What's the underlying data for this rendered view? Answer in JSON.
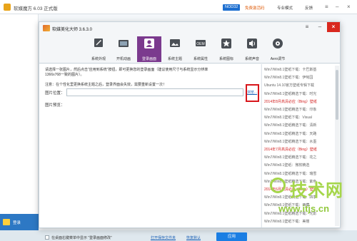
{
  "back_window": {
    "title": "软媒魔方 6.03 正式版",
    "nod_badge": "NOD32",
    "nod_text": "免费激活码",
    "menus": [
      "专业模式",
      "反馈"
    ],
    "bottom_label": "登录"
  },
  "dialog": {
    "title": "软媒美化大师 3.6.3.0",
    "toolbar": [
      {
        "label": "系统外观",
        "icon": "monitor-icon"
      },
      {
        "label": "开机动画",
        "icon": "boot-animation-icon"
      },
      {
        "label": "登录画面",
        "icon": "user-login-icon",
        "active": true
      },
      {
        "label": "系统主题",
        "icon": "theme-icon"
      },
      {
        "label": "系统属性",
        "icon": "system-properties-icon"
      },
      {
        "label": "系统图标",
        "icon": "star-icon"
      },
      {
        "label": "系统声音",
        "icon": "speaker-icon"
      },
      {
        "label": "Aero调节",
        "icon": "aero-icon"
      }
    ],
    "description": "请选择一张图片，然后点击“应用到系统”按钮，即可更换您的登录画面（建议使用尺寸与系统显示分辨率1366x768一致的图片）。",
    "note": "注意：在个性化里更换系统主题之后，登录界面会失效，需要重新设置一次！",
    "image_location_label": "图片位置：",
    "image_location_value": "",
    "browse_label": "浏览...",
    "preview_label": "图片预览：",
    "context_menu_checkbox_label": "在桌面右键菜单中显示 “登录画面修改”",
    "open_folder_link": "打开保存文件夹",
    "restore_default_link": "恢复默认",
    "apply_button": "应用"
  },
  "articles": [
    {
      "text": "Win7/Win8.1壁纸下载：卡巴斯基",
      "style": "gray"
    },
    {
      "text": "Win7/Win8.1壁纸下载：伊甸园",
      "style": "gray"
    },
    {
      "text": "Ubuntu 14.10官方壁纸专辑下载",
      "style": "gray"
    },
    {
      "text": "Win7/Win8.1壁纸精选下载：时光",
      "style": "gray"
    },
    {
      "text": "2014年8月高清必应（Bing）壁纸",
      "style": "red"
    },
    {
      "text": "Win7/Win8.1壁纸精选下载：印象",
      "style": "gray"
    },
    {
      "text": "Win7/Win8.1壁纸下载：Visual",
      "style": "gray"
    },
    {
      "text": "Win7/Win8.1壁纸精选下载：清新",
      "style": "gray"
    },
    {
      "text": "Win7/Win8.1壁纸精选下载：天路",
      "style": "gray"
    },
    {
      "text": "Win7/Win8.1壁纸精选下载：水墨",
      "style": "gray"
    },
    {
      "text": "2014年7月高清必应（Bing）壁纸",
      "style": "red"
    },
    {
      "text": "Win7/Win8.1壁纸精选下载：花之",
      "style": "gray"
    },
    {
      "text": "Win7/Win8.1壁纸：微软精选",
      "style": "gray"
    },
    {
      "text": "Win7/Win8.1壁纸精选下载：瑞雪",
      "style": "gray"
    },
    {
      "text": "Win7/Win8.1壁纸精选下载：紫色",
      "style": "gray"
    },
    {
      "text": "2014年6月高清必应（Bing）壁纸",
      "style": "red"
    },
    {
      "text": "Win7/Win8.1壁纸精选下载：四季",
      "style": "gray"
    },
    {
      "text": "Win7/Win8.1壁纸下载：西藏",
      "style": "gray"
    },
    {
      "text": "Win7/Win8.1壁纸精选下载：光影",
      "style": "gray"
    },
    {
      "text": "Win7/Win8.1壁纸下载：美丽",
      "style": "gray"
    }
  ],
  "watermark": {
    "brand": "技术网",
    "url": "www.itjs.cn"
  },
  "colors": {
    "active_tab": "#7b3a8e",
    "apply_button": "#1a7ee3",
    "highlight_border": "#d8161b",
    "close_button": "#d9281f",
    "watermark": "#a5d64a"
  }
}
